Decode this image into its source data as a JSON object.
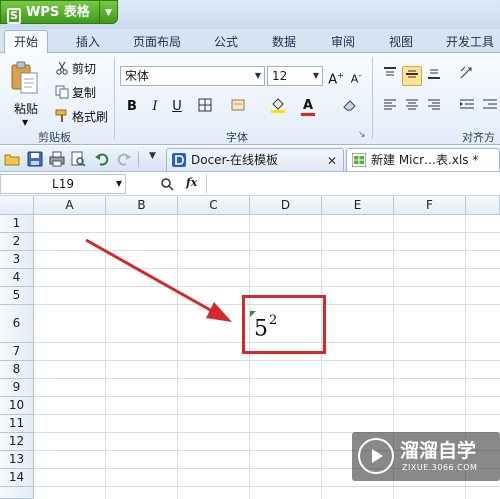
{
  "app": {
    "name": "WPS 表格",
    "logo_char": "S"
  },
  "ribbon_tabs": [
    "开始",
    "插入",
    "页面布局",
    "公式",
    "数据",
    "审阅",
    "视图",
    "开发工具"
  ],
  "clipboard": {
    "paste": "粘贴",
    "cut": "剪切",
    "copy": "复制",
    "format_painter": "格式刷",
    "group_label": "剪贴板"
  },
  "font": {
    "family": "宋体",
    "size": "12",
    "bold": "B",
    "italic": "I",
    "underline": "U",
    "group_label": "字体",
    "font_color": "A"
  },
  "alignment": {
    "group_label": "对齐方"
  },
  "doc_tabs": [
    {
      "label": "Docer-在线模板"
    },
    {
      "label": "新建 Micr…表.xls *"
    }
  ],
  "formula_bar": {
    "cell_ref": "L19",
    "fx": "fx"
  },
  "grid": {
    "columns": [
      "A",
      "B",
      "C",
      "D",
      "E",
      "F"
    ],
    "rows": [
      "1",
      "2",
      "3",
      "4",
      "5",
      "6",
      "7",
      "8",
      "9",
      "10",
      "11",
      "12",
      "13",
      "14"
    ],
    "cell_D6": {
      "base": "5",
      "exponent": "2"
    }
  },
  "watermark": {
    "name": "溜溜自学",
    "url": "ZIXUE.3066.COM"
  },
  "colors": {
    "annotation_red": "#d3292b",
    "app_green": "#4aa82a",
    "ribbon_blue": "#d6e3f3"
  }
}
